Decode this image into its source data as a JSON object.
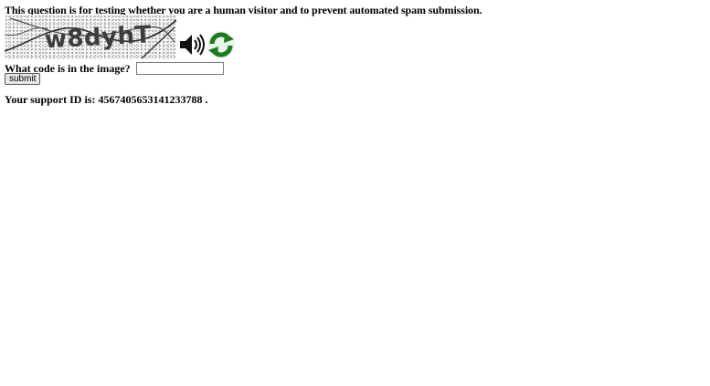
{
  "intro_text": "This question is for testing whether you are a human visitor and to prevent automated spam submission.",
  "captcha": {
    "code_text": "w8dyhT",
    "audio_icon": "speaker-icon",
    "refresh_icon": "refresh-icon"
  },
  "form": {
    "question_label": "What code is in the image?",
    "input_value": "",
    "submit_label": "submit"
  },
  "support": {
    "text": "Your support ID is: 4567405653141233788 ."
  },
  "colors": {
    "refresh_green": "#1f7a1f",
    "speaker": "#111111"
  }
}
